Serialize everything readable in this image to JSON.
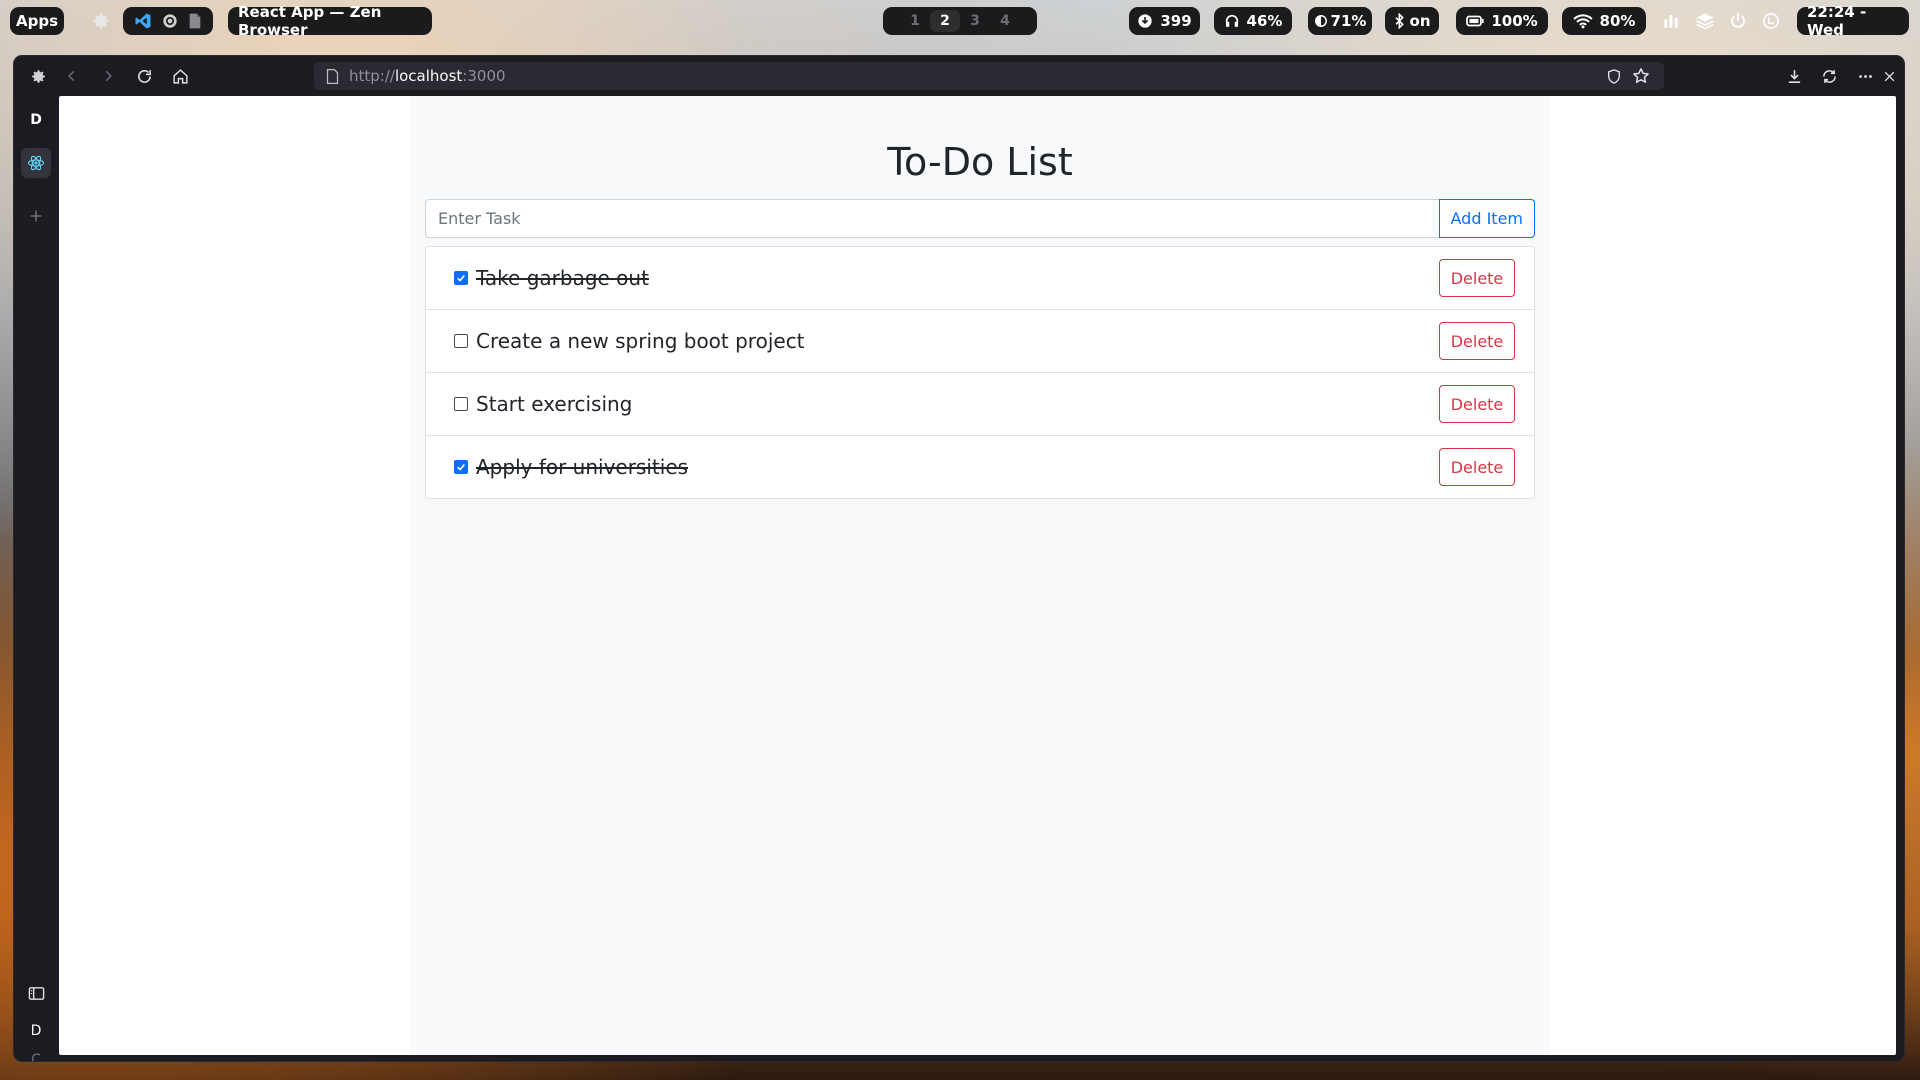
{
  "topbar": {
    "apps_label": "Apps",
    "window_title": "React App — Zen Browser",
    "workspaces": [
      "1",
      "2",
      "3",
      "4"
    ],
    "active_workspace": "2",
    "updates": "399",
    "volume": "46%",
    "brightness": "71%",
    "bluetooth": "on",
    "battery": "100%",
    "wifi": "80%",
    "clock": "22:24 - Wed"
  },
  "browser": {
    "url_scheme": "http://",
    "url_host": "localhost",
    "url_port": ":3000",
    "sidebar": {
      "top_workspace_letter": "D",
      "bottom_letters": [
        "D",
        "C"
      ]
    }
  },
  "app": {
    "title": "To-Do List",
    "input_placeholder": "Enter Task",
    "add_label": "Add Item",
    "delete_label": "Delete",
    "tasks": [
      {
        "text": "Take garbage out",
        "done": true
      },
      {
        "text": "Create a new spring boot project",
        "done": false
      },
      {
        "text": "Start exercising",
        "done": false
      },
      {
        "text": "Apply for universities",
        "done": true
      }
    ]
  },
  "colors": {
    "primary": "#0d6efd",
    "danger": "#dc3545",
    "bar_bg": "#1b1b1d",
    "browser_chrome": "#1c1b22"
  }
}
